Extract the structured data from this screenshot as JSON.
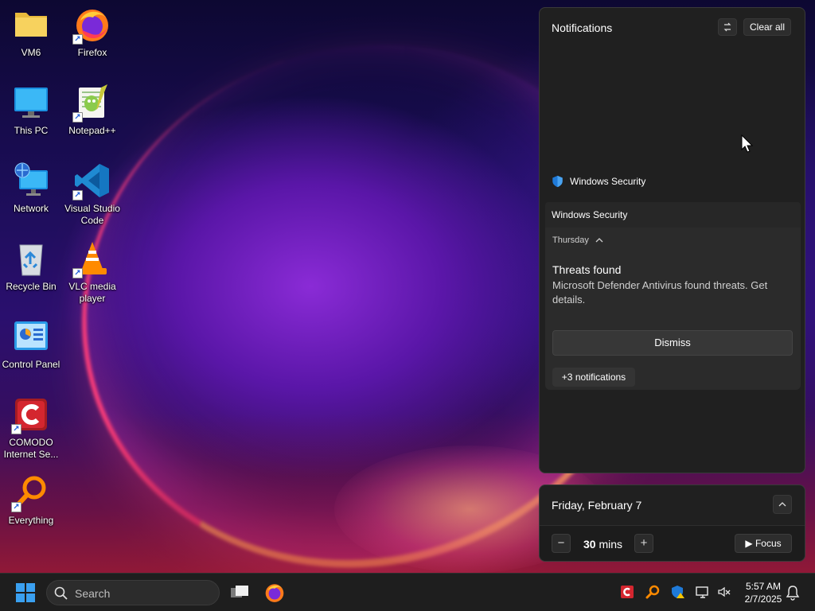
{
  "desktop": {
    "icons": [
      {
        "id": "vm6",
        "label": "VM6",
        "icon": "folder-icon"
      },
      {
        "id": "firefox",
        "label": "Firefox",
        "icon": "firefox-icon"
      },
      {
        "id": "this-pc",
        "label": "This PC",
        "icon": "monitor-icon"
      },
      {
        "id": "notepadpp",
        "label": "Notepad++",
        "icon": "notepadpp-icon"
      },
      {
        "id": "network",
        "label": "Network",
        "icon": "network-icon"
      },
      {
        "id": "vscode",
        "label": "Visual Studio Code",
        "icon": "vscode-icon"
      },
      {
        "id": "recycle-bin",
        "label": "Recycle Bin",
        "icon": "recycle-bin-icon"
      },
      {
        "id": "vlc",
        "label": "VLC media player",
        "icon": "vlc-icon"
      },
      {
        "id": "control-panel",
        "label": "Control Panel",
        "icon": "control-panel-icon"
      },
      {
        "id": "comodo",
        "label": "COMODO Internet Se...",
        "icon": "comodo-icon"
      },
      {
        "id": "everything",
        "label": "Everything",
        "icon": "everything-icon"
      }
    ]
  },
  "notifications": {
    "title": "Notifications",
    "dnd_icon": "do-not-disturb-icon",
    "clear_all_label": "Clear all",
    "app_name": "Windows Security",
    "group_header": "Windows Security",
    "day_label": "Thursday",
    "threat_title": "Threats found",
    "threat_body": "Microsoft Defender Antivirus found threats. Get details.",
    "dismiss_label": "Dismiss",
    "more_label": "+3 notifications"
  },
  "calendar": {
    "date_label": "Friday, February 7",
    "focus_minutes": "30",
    "focus_unit": "mins",
    "minus_label": "−",
    "plus_label": "+",
    "focus_button_label": "Focus"
  },
  "taskbar": {
    "search_placeholder": "Search",
    "clock_time": "5:57 AM",
    "clock_date": "2/7/2025"
  },
  "colors": {
    "panel_bg": "#202020",
    "taskbar_bg": "#1e1e1e",
    "accent_blue": "#0a78d7",
    "comodo_red": "#d4262f"
  }
}
